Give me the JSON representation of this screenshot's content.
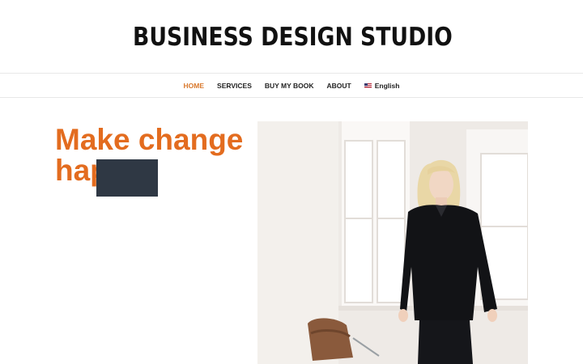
{
  "brand": {
    "name": "BUSINESS DESIGN STUDIO",
    "logo_icon": "eye-brushstroke-icon",
    "accent": "#e36c1f"
  },
  "nav": {
    "items": [
      {
        "label": "HOME",
        "active": true
      },
      {
        "label": "SERVICES",
        "active": false
      },
      {
        "label": "BUY MY BOOK",
        "active": false
      },
      {
        "label": "ABOUT",
        "active": false
      }
    ],
    "language": {
      "label": "English",
      "icon": "us-flag-icon"
    }
  },
  "hero": {
    "title_line1": "Make change",
    "title_line2": "hap"
  },
  "photo": {
    "description_icon": "portrait-photo"
  }
}
